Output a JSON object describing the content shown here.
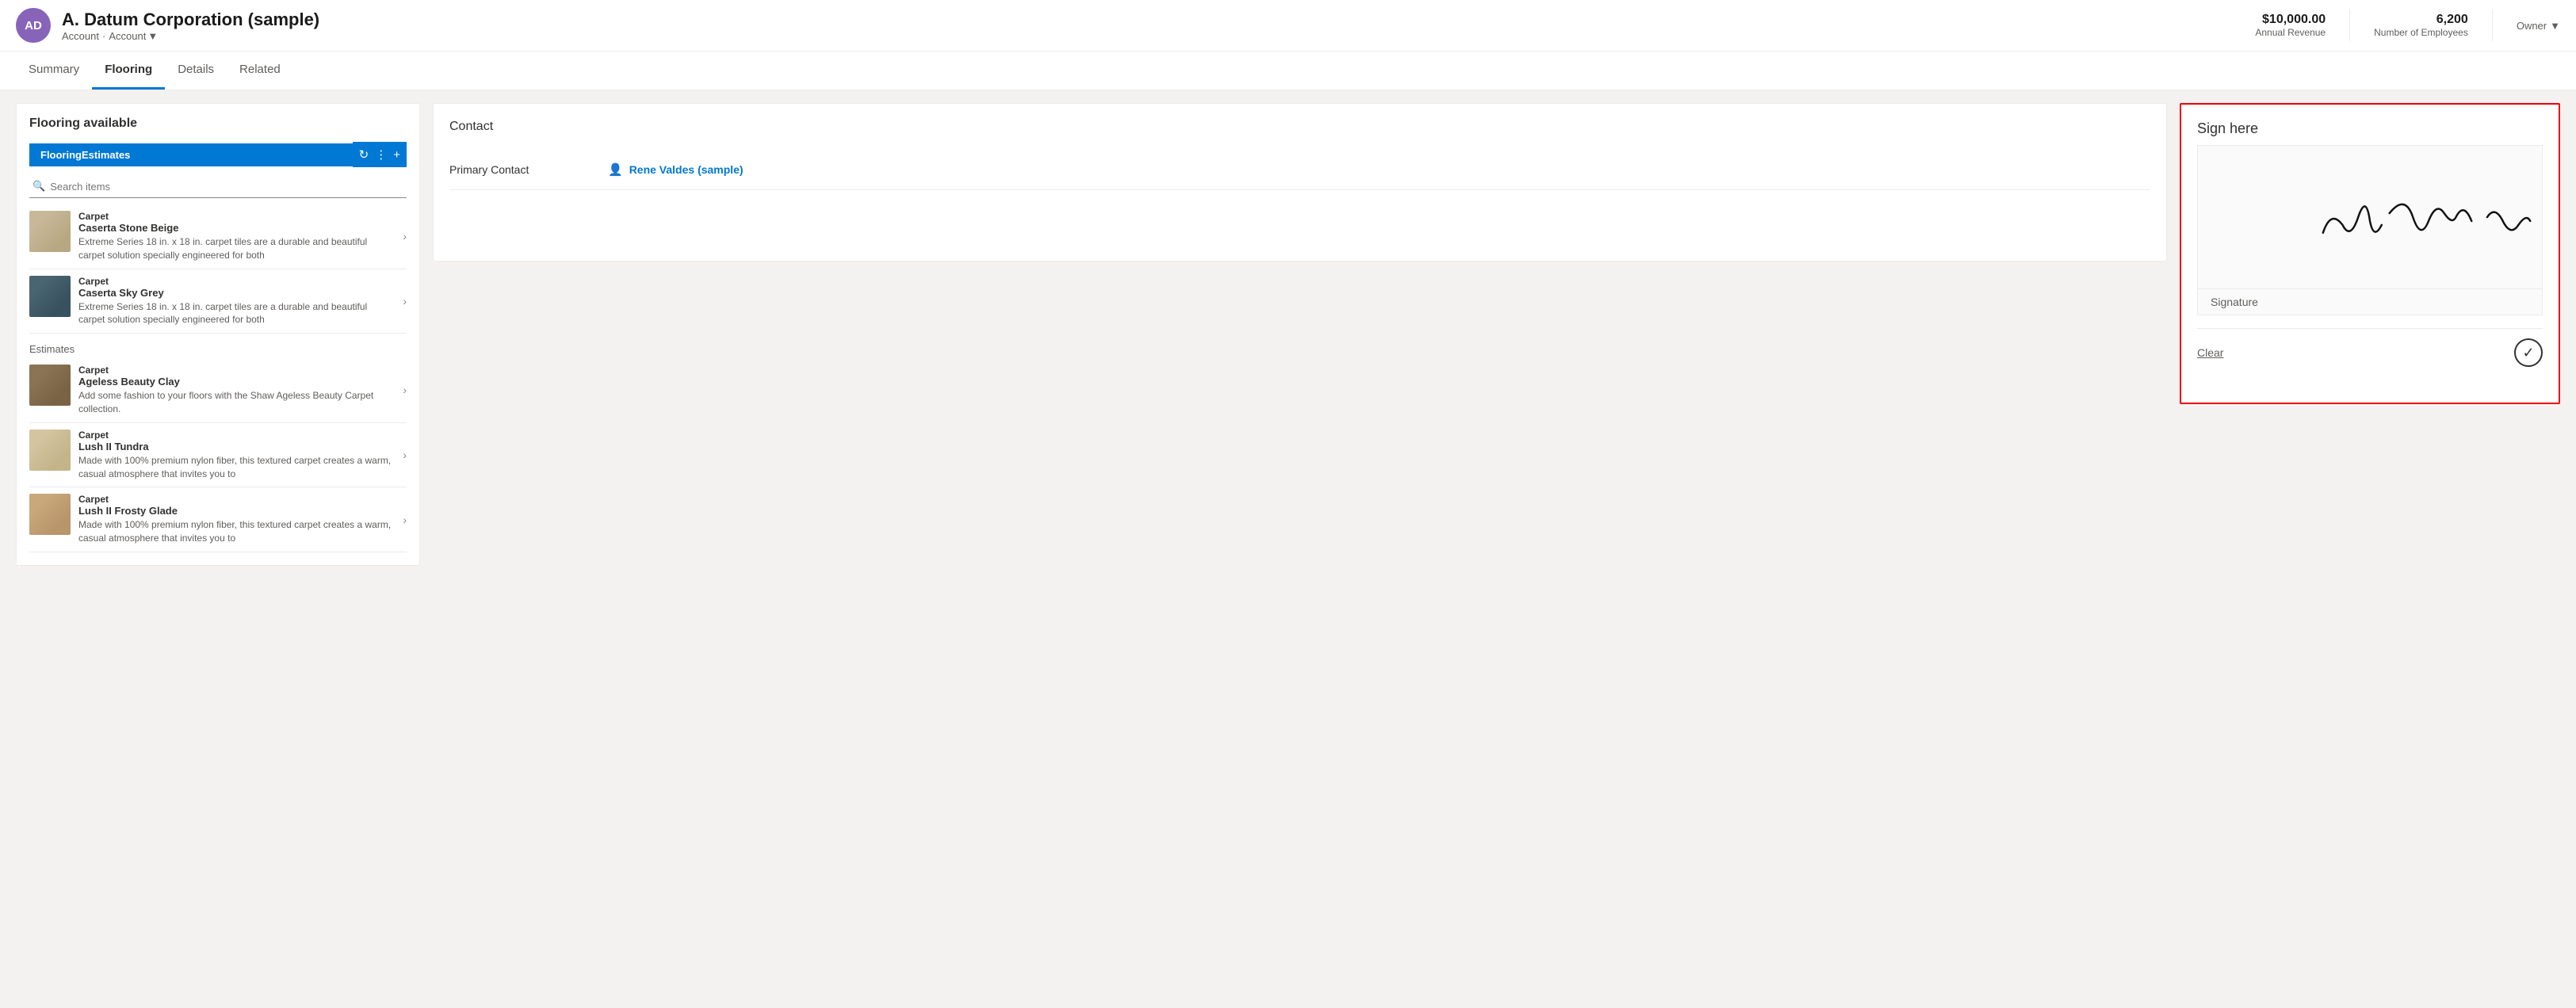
{
  "header": {
    "avatar_initials": "AD",
    "title": "A. Datum Corporation (sample)",
    "breadcrumb1": "Account",
    "breadcrumb_sep": "·",
    "breadcrumb2": "Account",
    "annual_revenue_value": "$10,000.00",
    "annual_revenue_label": "Annual Revenue",
    "employees_value": "6,200",
    "employees_label": "Number of Employees",
    "owner_label": "Owner"
  },
  "nav": {
    "tabs": [
      {
        "id": "summary",
        "label": "Summary",
        "active": false
      },
      {
        "id": "flooring",
        "label": "Flooring",
        "active": true
      },
      {
        "id": "details",
        "label": "Details",
        "active": false
      },
      {
        "id": "related",
        "label": "Related",
        "active": false
      }
    ]
  },
  "left_panel": {
    "title": "Flooring available",
    "tab_button_label": "FlooringEstimates",
    "search_placeholder": "Search items",
    "section_label": "Estimates",
    "items": [
      {
        "category": "Carpet",
        "name": "Caserta Stone Beige",
        "desc": "Extreme Series 18 in. x 18 in. carpet tiles are a durable and beautiful carpet solution specially engineered for both",
        "color_class": "carpet-beige"
      },
      {
        "category": "Carpet",
        "name": "Caserta Sky Grey",
        "desc": "Extreme Series 18 in. x 18 in. carpet tiles are a durable and beautiful carpet solution specially engineered for both",
        "color_class": "carpet-grey"
      },
      {
        "category": "Carpet",
        "name": "Ageless Beauty Clay",
        "desc": "Add some fashion to your floors with the Shaw Ageless Beauty Carpet collection.",
        "color_class": "carpet-clay"
      },
      {
        "category": "Carpet",
        "name": "Lush II Tundra",
        "desc": "Made with 100% premium nylon fiber, this textured carpet creates a warm, casual atmosphere that invites you to",
        "color_class": "carpet-tundra"
      },
      {
        "category": "Carpet",
        "name": "Lush II Frosty Glade",
        "desc": "Made with 100% premium nylon fiber, this textured carpet creates a warm, casual atmosphere that invites you to",
        "color_class": "carpet-frosty"
      }
    ]
  },
  "middle_panel": {
    "title": "Contact",
    "primary_contact_label": "Primary Contact",
    "primary_contact_value": "Rene Valdes (sample)"
  },
  "right_panel": {
    "title": "Sign here",
    "signature_label": "Signature",
    "clear_label": "Clear",
    "border_color": "#cc0000"
  }
}
